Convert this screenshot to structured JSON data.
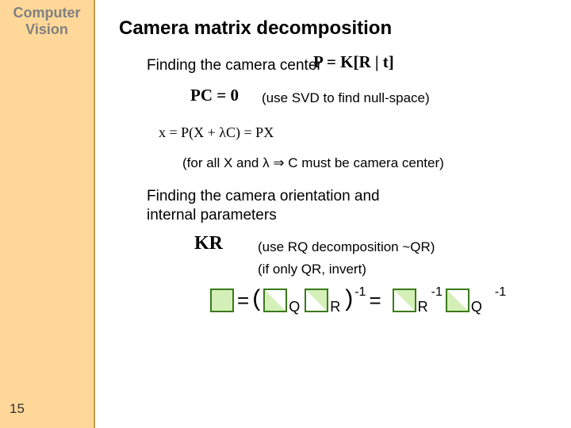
{
  "sidebar": {
    "line1": "Computer",
    "line2": "Vision"
  },
  "title": "Camera matrix decomposition",
  "section1": "Finding the camera center",
  "eq_p": "P = K[R | t]",
  "eq_pc0": "PC = 0",
  "note_svd": "(use SVD to find null-space)",
  "eq_xpx": "x = P(X + λC) = PX",
  "note_forall": "(for all X and λ ⇒ C must be camera center)",
  "section2": "Finding the camera orientation and internal parameters",
  "eq_kr": "KR",
  "note_rq": "(use RQ decomposition ~QR)",
  "note_invert": "(if only QR, invert)",
  "tokens": {
    "eq": "=",
    "lparen": "(",
    "rparen": ")",
    "Q": "Q",
    "R": "R",
    "neg1": "-1"
  },
  "page": "15"
}
